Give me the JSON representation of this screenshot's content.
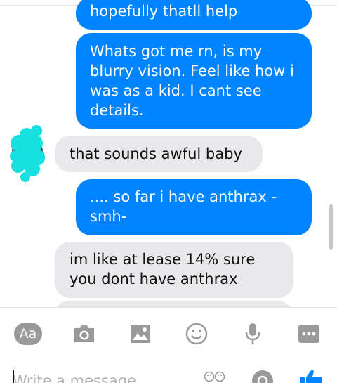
{
  "messages": [
    {
      "side": "out",
      "text": "hopefully thatll help"
    },
    {
      "side": "out",
      "text": "Whats got me rn, is my blurry vision. Feel like how i was as a kid. I cant see details."
    },
    {
      "side": "in",
      "text": "that sounds awful baby"
    },
    {
      "side": "out",
      "text": ".... so far i have anthrax - smh-"
    },
    {
      "side": "in",
      "text": "im like at lease 14% sure you dont have anthrax"
    }
  ],
  "toolbar": {
    "aa_label": "Aa",
    "icons": [
      "text-size-icon",
      "camera-icon",
      "image-icon",
      "emoji-icon",
      "microphone-icon",
      "more-icon"
    ]
  },
  "composer": {
    "placeholder": "Write a message...",
    "send_icon": "thumbs-up-icon"
  },
  "colors": {
    "outgoing": "#0084ff",
    "incoming": "#e9e9eb",
    "icon": "#9a9a9a",
    "accent": "#0084ff",
    "scribble": "#18e0e0"
  }
}
